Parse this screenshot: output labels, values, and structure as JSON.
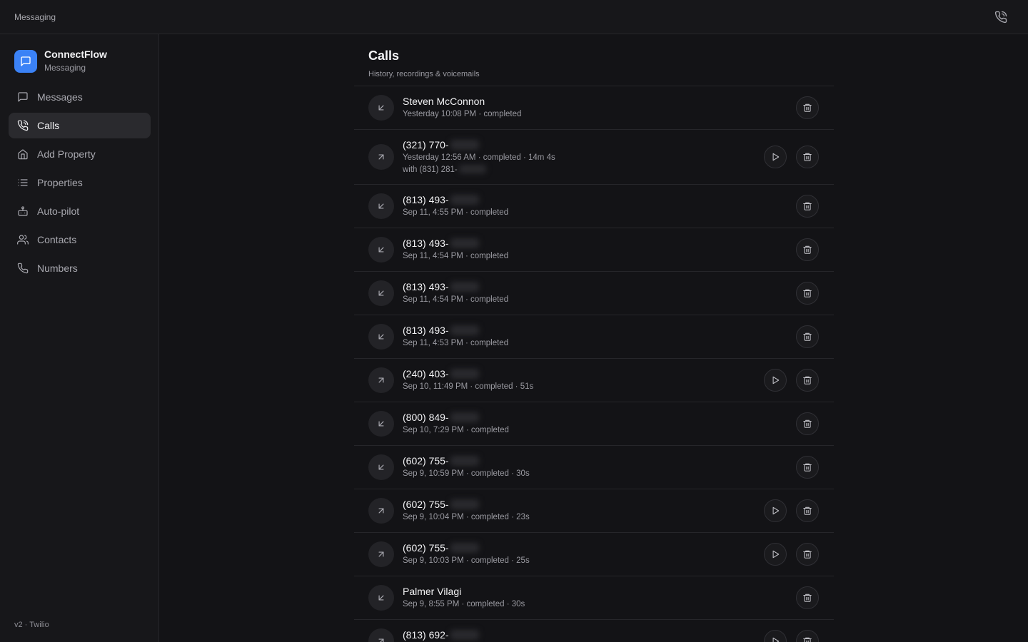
{
  "topbar": {
    "title": "Messaging",
    "phone_icon": "phone-call-icon"
  },
  "brand": {
    "name": "ConnectFlow",
    "subtitle": "Messaging",
    "icon": "chat-bubble-icon",
    "color": "#3b82f6"
  },
  "nav": [
    {
      "label": "Messages",
      "icon": "message-square-icon",
      "active": false
    },
    {
      "label": "Calls",
      "icon": "phone-call-icon",
      "active": true
    },
    {
      "label": "Add Property",
      "icon": "home-icon",
      "active": false
    },
    {
      "label": "Properties",
      "icon": "list-icon",
      "active": false
    },
    {
      "label": "Auto-pilot",
      "icon": "bot-icon",
      "active": false
    },
    {
      "label": "Contacts",
      "icon": "users-icon",
      "active": false
    },
    {
      "label": "Numbers",
      "icon": "phone-icon",
      "active": false
    }
  ],
  "footer": {
    "version": "v2 · Twilio"
  },
  "page": {
    "title": "Calls",
    "subtitle": "History, recordings & voicemails"
  },
  "calls": [
    {
      "name": "Steven McConnon",
      "redacted": false,
      "direction": "incoming",
      "meta": "Yesterday 10:08 PM · completed",
      "with": null,
      "recording": false
    },
    {
      "name": "(321) 770-",
      "redacted": true,
      "direction": "outgoing",
      "meta": "Yesterday 12:56 AM · completed · 14m 4s",
      "with": "with (831) 281-",
      "recording": true
    },
    {
      "name": "(813) 493-",
      "redacted": true,
      "direction": "incoming",
      "meta": "Sep 11, 4:55 PM · completed",
      "with": null,
      "recording": false
    },
    {
      "name": "(813) 493-",
      "redacted": true,
      "direction": "incoming",
      "meta": "Sep 11, 4:54 PM · completed",
      "with": null,
      "recording": false
    },
    {
      "name": "(813) 493-",
      "redacted": true,
      "direction": "incoming",
      "meta": "Sep 11, 4:54 PM · completed",
      "with": null,
      "recording": false
    },
    {
      "name": "(813) 493-",
      "redacted": true,
      "direction": "incoming",
      "meta": "Sep 11, 4:53 PM · completed",
      "with": null,
      "recording": false
    },
    {
      "name": "(240) 403-",
      "redacted": true,
      "direction": "outgoing",
      "meta": "Sep 10, 11:49 PM · completed · 51s",
      "with": null,
      "recording": true
    },
    {
      "name": "(800) 849-",
      "redacted": true,
      "direction": "incoming",
      "meta": "Sep 10, 7:29 PM · completed",
      "with": null,
      "recording": false
    },
    {
      "name": "(602) 755-",
      "redacted": true,
      "direction": "incoming",
      "meta": "Sep 9, 10:59 PM · completed · 30s",
      "with": null,
      "recording": false
    },
    {
      "name": "(602) 755-",
      "redacted": true,
      "direction": "outgoing",
      "meta": "Sep 9, 10:04 PM · completed · 23s",
      "with": null,
      "recording": true
    },
    {
      "name": "(602) 755-",
      "redacted": true,
      "direction": "outgoing",
      "meta": "Sep 9, 10:03 PM · completed · 25s",
      "with": null,
      "recording": true
    },
    {
      "name": "Palmer Vilagi",
      "redacted": false,
      "direction": "incoming",
      "meta": "Sep 9, 8:55 PM · completed · 30s",
      "with": null,
      "recording": false
    },
    {
      "name": "(813) 692-",
      "redacted": true,
      "direction": "outgoing",
      "meta": "",
      "with": null,
      "recording": true
    }
  ]
}
